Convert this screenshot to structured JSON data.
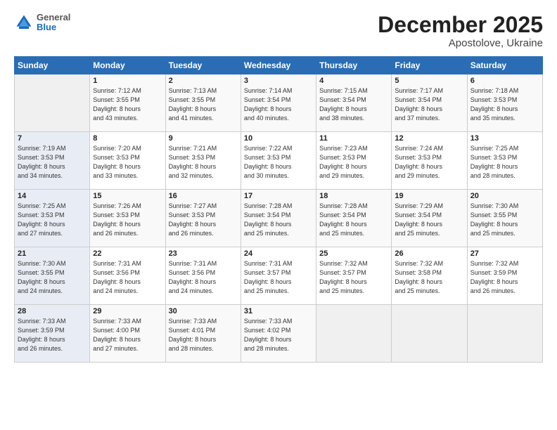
{
  "header": {
    "logo": {
      "general": "General",
      "blue": "Blue"
    },
    "title": "December 2025",
    "subtitle": "Apostolove, Ukraine"
  },
  "calendar": {
    "days_of_week": [
      "Sunday",
      "Monday",
      "Tuesday",
      "Wednesday",
      "Thursday",
      "Friday",
      "Saturday"
    ],
    "weeks": [
      [
        {
          "day": "",
          "info": ""
        },
        {
          "day": "1",
          "info": "Sunrise: 7:12 AM\nSunset: 3:55 PM\nDaylight: 8 hours\nand 43 minutes."
        },
        {
          "day": "2",
          "info": "Sunrise: 7:13 AM\nSunset: 3:55 PM\nDaylight: 8 hours\nand 41 minutes."
        },
        {
          "day": "3",
          "info": "Sunrise: 7:14 AM\nSunset: 3:54 PM\nDaylight: 8 hours\nand 40 minutes."
        },
        {
          "day": "4",
          "info": "Sunrise: 7:15 AM\nSunset: 3:54 PM\nDaylight: 8 hours\nand 38 minutes."
        },
        {
          "day": "5",
          "info": "Sunrise: 7:17 AM\nSunset: 3:54 PM\nDaylight: 8 hours\nand 37 minutes."
        },
        {
          "day": "6",
          "info": "Sunrise: 7:18 AM\nSunset: 3:53 PM\nDaylight: 8 hours\nand 35 minutes."
        }
      ],
      [
        {
          "day": "7",
          "info": "Sunrise: 7:19 AM\nSunset: 3:53 PM\nDaylight: 8 hours\nand 34 minutes."
        },
        {
          "day": "8",
          "info": "Sunrise: 7:20 AM\nSunset: 3:53 PM\nDaylight: 8 hours\nand 33 minutes."
        },
        {
          "day": "9",
          "info": "Sunrise: 7:21 AM\nSunset: 3:53 PM\nDaylight: 8 hours\nand 32 minutes."
        },
        {
          "day": "10",
          "info": "Sunrise: 7:22 AM\nSunset: 3:53 PM\nDaylight: 8 hours\nand 30 minutes."
        },
        {
          "day": "11",
          "info": "Sunrise: 7:23 AM\nSunset: 3:53 PM\nDaylight: 8 hours\nand 29 minutes."
        },
        {
          "day": "12",
          "info": "Sunrise: 7:24 AM\nSunset: 3:53 PM\nDaylight: 8 hours\nand 29 minutes."
        },
        {
          "day": "13",
          "info": "Sunrise: 7:25 AM\nSunset: 3:53 PM\nDaylight: 8 hours\nand 28 minutes."
        }
      ],
      [
        {
          "day": "14",
          "info": "Sunrise: 7:25 AM\nSunset: 3:53 PM\nDaylight: 8 hours\nand 27 minutes."
        },
        {
          "day": "15",
          "info": "Sunrise: 7:26 AM\nSunset: 3:53 PM\nDaylight: 8 hours\nand 26 minutes."
        },
        {
          "day": "16",
          "info": "Sunrise: 7:27 AM\nSunset: 3:53 PM\nDaylight: 8 hours\nand 26 minutes."
        },
        {
          "day": "17",
          "info": "Sunrise: 7:28 AM\nSunset: 3:54 PM\nDaylight: 8 hours\nand 25 minutes."
        },
        {
          "day": "18",
          "info": "Sunrise: 7:28 AM\nSunset: 3:54 PM\nDaylight: 8 hours\nand 25 minutes."
        },
        {
          "day": "19",
          "info": "Sunrise: 7:29 AM\nSunset: 3:54 PM\nDaylight: 8 hours\nand 25 minutes."
        },
        {
          "day": "20",
          "info": "Sunrise: 7:30 AM\nSunset: 3:55 PM\nDaylight: 8 hours\nand 25 minutes."
        }
      ],
      [
        {
          "day": "21",
          "info": "Sunrise: 7:30 AM\nSunset: 3:55 PM\nDaylight: 8 hours\nand 24 minutes."
        },
        {
          "day": "22",
          "info": "Sunrise: 7:31 AM\nSunset: 3:56 PM\nDaylight: 8 hours\nand 24 minutes."
        },
        {
          "day": "23",
          "info": "Sunrise: 7:31 AM\nSunset: 3:56 PM\nDaylight: 8 hours\nand 24 minutes."
        },
        {
          "day": "24",
          "info": "Sunrise: 7:31 AM\nSunset: 3:57 PM\nDaylight: 8 hours\nand 25 minutes."
        },
        {
          "day": "25",
          "info": "Sunrise: 7:32 AM\nSunset: 3:57 PM\nDaylight: 8 hours\nand 25 minutes."
        },
        {
          "day": "26",
          "info": "Sunrise: 7:32 AM\nSunset: 3:58 PM\nDaylight: 8 hours\nand 25 minutes."
        },
        {
          "day": "27",
          "info": "Sunrise: 7:32 AM\nSunset: 3:59 PM\nDaylight: 8 hours\nand 26 minutes."
        }
      ],
      [
        {
          "day": "28",
          "info": "Sunrise: 7:33 AM\nSunset: 3:59 PM\nDaylight: 8 hours\nand 26 minutes."
        },
        {
          "day": "29",
          "info": "Sunrise: 7:33 AM\nSunset: 4:00 PM\nDaylight: 8 hours\nand 27 minutes."
        },
        {
          "day": "30",
          "info": "Sunrise: 7:33 AM\nSunset: 4:01 PM\nDaylight: 8 hours\nand 28 minutes."
        },
        {
          "day": "31",
          "info": "Sunrise: 7:33 AM\nSunset: 4:02 PM\nDaylight: 8 hours\nand 28 minutes."
        },
        {
          "day": "",
          "info": ""
        },
        {
          "day": "",
          "info": ""
        },
        {
          "day": "",
          "info": ""
        }
      ]
    ]
  }
}
